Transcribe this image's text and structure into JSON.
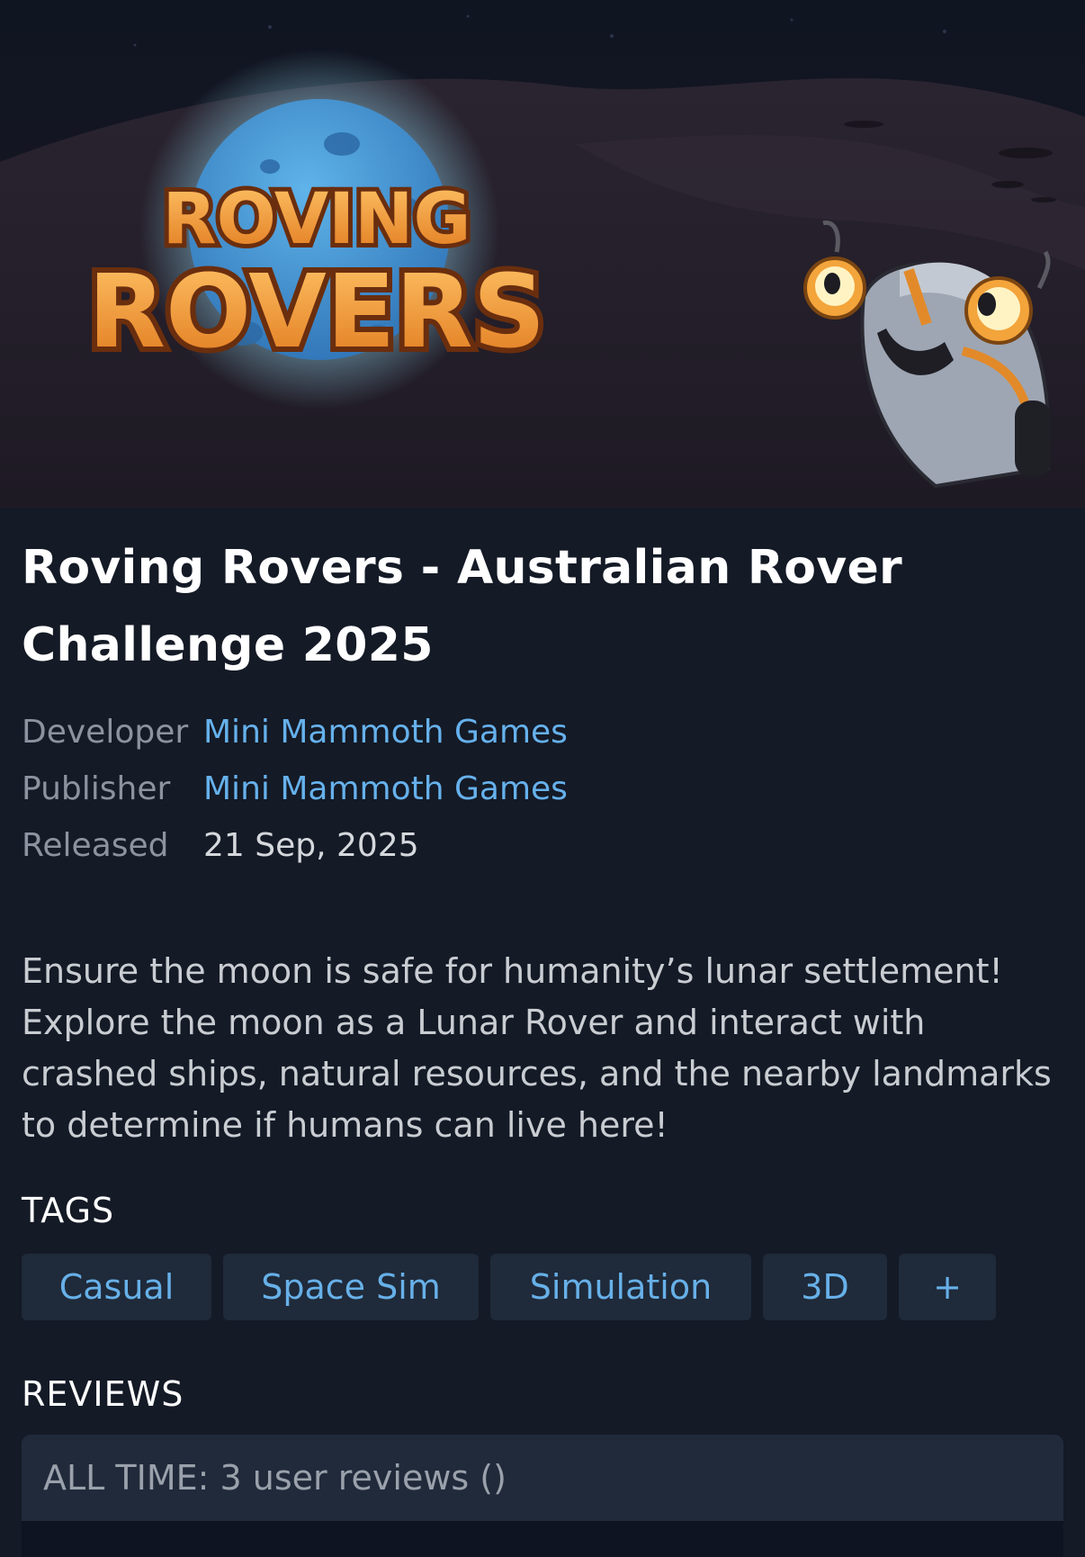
{
  "hero": {
    "logo_line1": "ROVING",
    "logo_line2": "ROVERS",
    "icons": [
      "moon-planet-icon",
      "rover-mascot-icon"
    ]
  },
  "game": {
    "title": "Roving Rovers - Australian Rover Challenge 2025",
    "developer_label": "Developer",
    "developer": "Mini Mammoth Games",
    "publisher_label": "Publisher",
    "publisher": "Mini Mammoth Games",
    "released_label": "Released",
    "released": "21 Sep, 2025",
    "description": "Ensure the moon is safe for humanity’s lunar settlement! Explore the moon as a Lunar Rover and interact with crashed ships, natural resources, and the nearby landmarks to determine if humans can live here!"
  },
  "tags": {
    "heading": "TAGS",
    "items": [
      "Casual",
      "Space Sim",
      "Simulation",
      "3D",
      "+"
    ]
  },
  "reviews": {
    "heading": "REVIEWS",
    "all_time": "ALL TIME: 3 user reviews ()"
  },
  "colors": {
    "background": "#141a26",
    "link": "#66b1ec",
    "tag_bg": "#1f2a3a",
    "logo_orange": "#f0952a",
    "planet_blue": "#4a9fd8"
  }
}
